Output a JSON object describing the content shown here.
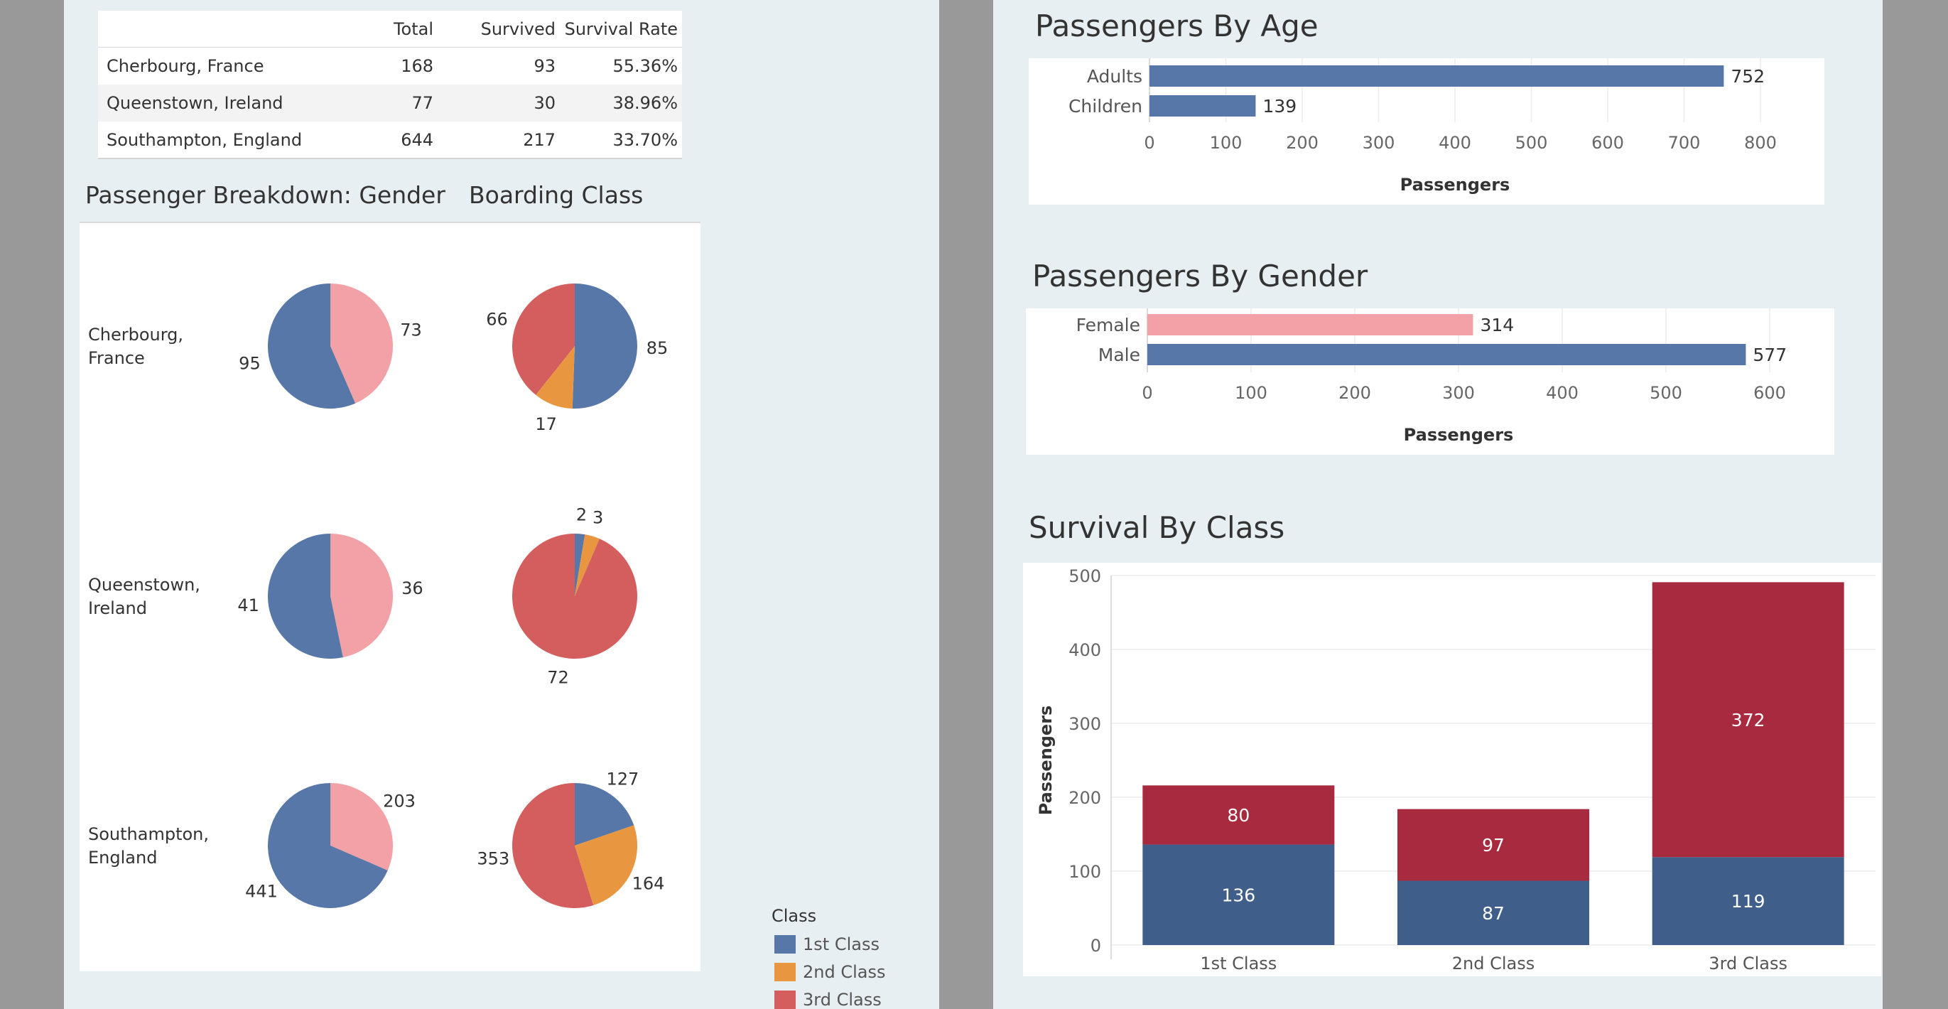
{
  "colors": {
    "blue": "#5677a7",
    "pink": "#f2a1a7",
    "orange": "#e8963f",
    "red": "#d45e5e",
    "dark_blue": "#3f5f8a",
    "dark_red": "#a82a3f",
    "panel_bg": "#e8eff2",
    "frame_bg": "#999999"
  },
  "summary_table": {
    "columns": [
      "Total",
      "Survived",
      "Survival Rate"
    ],
    "rows": [
      {
        "port": "Cherbourg, France",
        "total": "168",
        "survived": "93",
        "rate": "55.36%"
      },
      {
        "port": "Queenstown, Ireland",
        "total": "77",
        "survived": "30",
        "rate": "38.96%"
      },
      {
        "port": "Southampton, England",
        "total": "644",
        "survived": "217",
        "rate": "33.70%"
      }
    ]
  },
  "breakdown": {
    "title_gender": "Passenger Breakdown: Gender",
    "title_class": "Boarding Class"
  },
  "legend": {
    "title": "Class",
    "items": [
      {
        "label": "1st Class",
        "color": "#5677a7"
      },
      {
        "label": "2nd Class",
        "color": "#e8963f"
      },
      {
        "label": "3rd Class",
        "color": "#d45e5e"
      }
    ]
  },
  "chart_data": [
    {
      "type": "pie",
      "title": "Passenger Breakdown: Gender",
      "groups": [
        {
          "name": "Cherbourg, France",
          "slices": [
            {
              "series": "Female",
              "value": 73
            },
            {
              "series": "Male",
              "value": 95
            }
          ]
        },
        {
          "name": "Queenstown, Ireland",
          "slices": [
            {
              "series": "Female",
              "value": 36
            },
            {
              "series": "Male",
              "value": 41
            }
          ]
        },
        {
          "name": "Southampton, England",
          "slices": [
            {
              "series": "Female",
              "value": 203
            },
            {
              "series": "Male",
              "value": 441
            }
          ]
        }
      ]
    },
    {
      "type": "pie",
      "title": "Boarding Class",
      "groups": [
        {
          "name": "Cherbourg, France",
          "slices": [
            {
              "series": "1st Class",
              "value": 85
            },
            {
              "series": "2nd Class",
              "value": 17
            },
            {
              "series": "3rd Class",
              "value": 66
            }
          ]
        },
        {
          "name": "Queenstown, Ireland",
          "slices": [
            {
              "series": "1st Class",
              "value": 2
            },
            {
              "series": "2nd Class",
              "value": 3
            },
            {
              "series": "3rd Class",
              "value": 72
            }
          ]
        },
        {
          "name": "Southampton, England",
          "slices": [
            {
              "series": "1st Class",
              "value": 127
            },
            {
              "series": "2nd Class",
              "value": 164
            },
            {
              "series": "3rd Class",
              "value": 353
            }
          ]
        }
      ]
    },
    {
      "type": "bar",
      "orientation": "horizontal",
      "title": "Passengers By Age",
      "categories": [
        "Adults",
        "Children"
      ],
      "values": [
        752,
        139
      ],
      "xlabel": "Passengers",
      "xlim": [
        0,
        800
      ],
      "xticks": [
        0,
        100,
        200,
        300,
        400,
        500,
        600,
        700,
        800
      ],
      "grid": true
    },
    {
      "type": "bar",
      "orientation": "horizontal",
      "title": "Passengers By Gender",
      "categories": [
        "Female",
        "Male"
      ],
      "values": [
        314,
        577
      ],
      "xlabel": "Passengers",
      "xlim": [
        0,
        600
      ],
      "xticks": [
        0,
        100,
        200,
        300,
        400,
        500,
        600
      ],
      "grid": true
    },
    {
      "type": "bar",
      "stacked": true,
      "title": "Survival By Class",
      "categories": [
        "1st Class",
        "2nd Class",
        "3rd Class"
      ],
      "series": [
        {
          "values": [
            136,
            87,
            119
          ]
        },
        {
          "values": [
            80,
            97,
            372
          ]
        }
      ],
      "ylabel": "Passengers",
      "ylim": [
        0,
        500
      ],
      "yticks": [
        0,
        100,
        200,
        300,
        400,
        500
      ],
      "grid": true
    }
  ]
}
